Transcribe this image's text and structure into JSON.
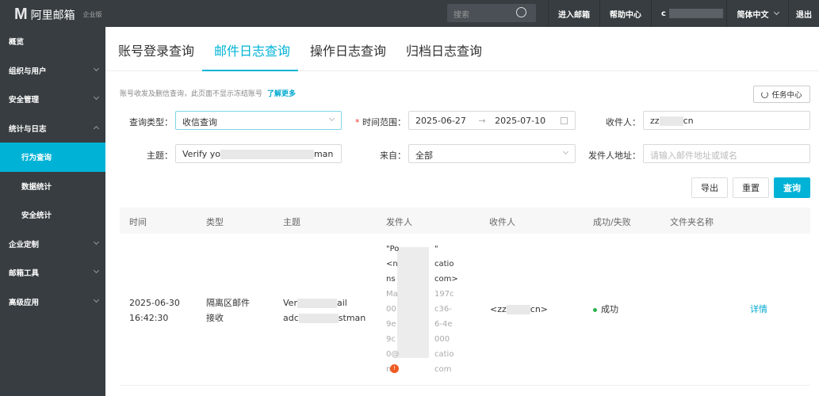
{
  "header": {
    "logo_mark": "M",
    "logo_text": "阿里邮箱",
    "edition": "企业版",
    "search_placeholder": "搜索",
    "enter_mailbox": "进入邮箱",
    "help": "帮助中心",
    "account": "c",
    "language": "简体中文",
    "logout": "退出"
  },
  "sidebar": {
    "items": [
      {
        "label": "概览"
      },
      {
        "label": "组织与用户"
      },
      {
        "label": "安全管理"
      },
      {
        "label": "统计与日志"
      },
      {
        "label": "行为查询"
      },
      {
        "label": "数据统计"
      },
      {
        "label": "安全统计"
      },
      {
        "label": "企业定制"
      },
      {
        "label": "邮箱工具"
      },
      {
        "label": "高级应用"
      }
    ]
  },
  "tabs": [
    {
      "label": "账号登录查询"
    },
    {
      "label": "邮件日志查询"
    },
    {
      "label": "操作日志查询"
    },
    {
      "label": "归档日志查询"
    }
  ],
  "hint": {
    "text": "账号收发及删信查询，此页面不显示冻结账号",
    "link": "了解更多"
  },
  "task_center": "任务中心",
  "form": {
    "query_type_label": "查询类型：",
    "query_type": "收信查询",
    "time_label": "时间范围：",
    "required": "*",
    "date_from": "2025-06-27",
    "date_sep": "→",
    "date_to": "2025-07-10",
    "recipient_label": "收件人：",
    "recipient_a": "zz",
    "recipient_b": "cn",
    "subject_label": "主题：",
    "subject_a": "Verify yo",
    "subject_b": "man",
    "from_label": "来自：",
    "from_value": "全部",
    "sender_label": "发件人地址：",
    "sender_placeholder": "请输入邮件地址或域名"
  },
  "buttons": {
    "export": "导出",
    "reset": "重置",
    "query": "查询"
  },
  "table": {
    "headers": [
      "时间",
      "类型",
      "主题",
      "发件人",
      "收件人",
      "成功/失败",
      "文件夹名称"
    ],
    "row": {
      "date": "2025-06-30",
      "time": "16:42:30",
      "type": "隔离区邮件接收",
      "subject_1": "Ver",
      "subject_1b": "ail",
      "subject_2": "adc",
      "subject_2b": "stman",
      "sender_lines": [
        "\"Po",
        "<n",
        "ns"
      ],
      "sender_lines_r": [
        "\"",
        "catio",
        "com>"
      ],
      "sender_gray": [
        "Ma",
        "00",
        "9e",
        "9c",
        "0@",
        "ns."
      ],
      "sender_gray_r": [
        "197c",
        "c36-",
        "6-4e",
        "000",
        "catio",
        "com"
      ],
      "recipient_a": "<zz",
      "recipient_b": "cn>",
      "status": "成功",
      "action": "详情"
    }
  }
}
